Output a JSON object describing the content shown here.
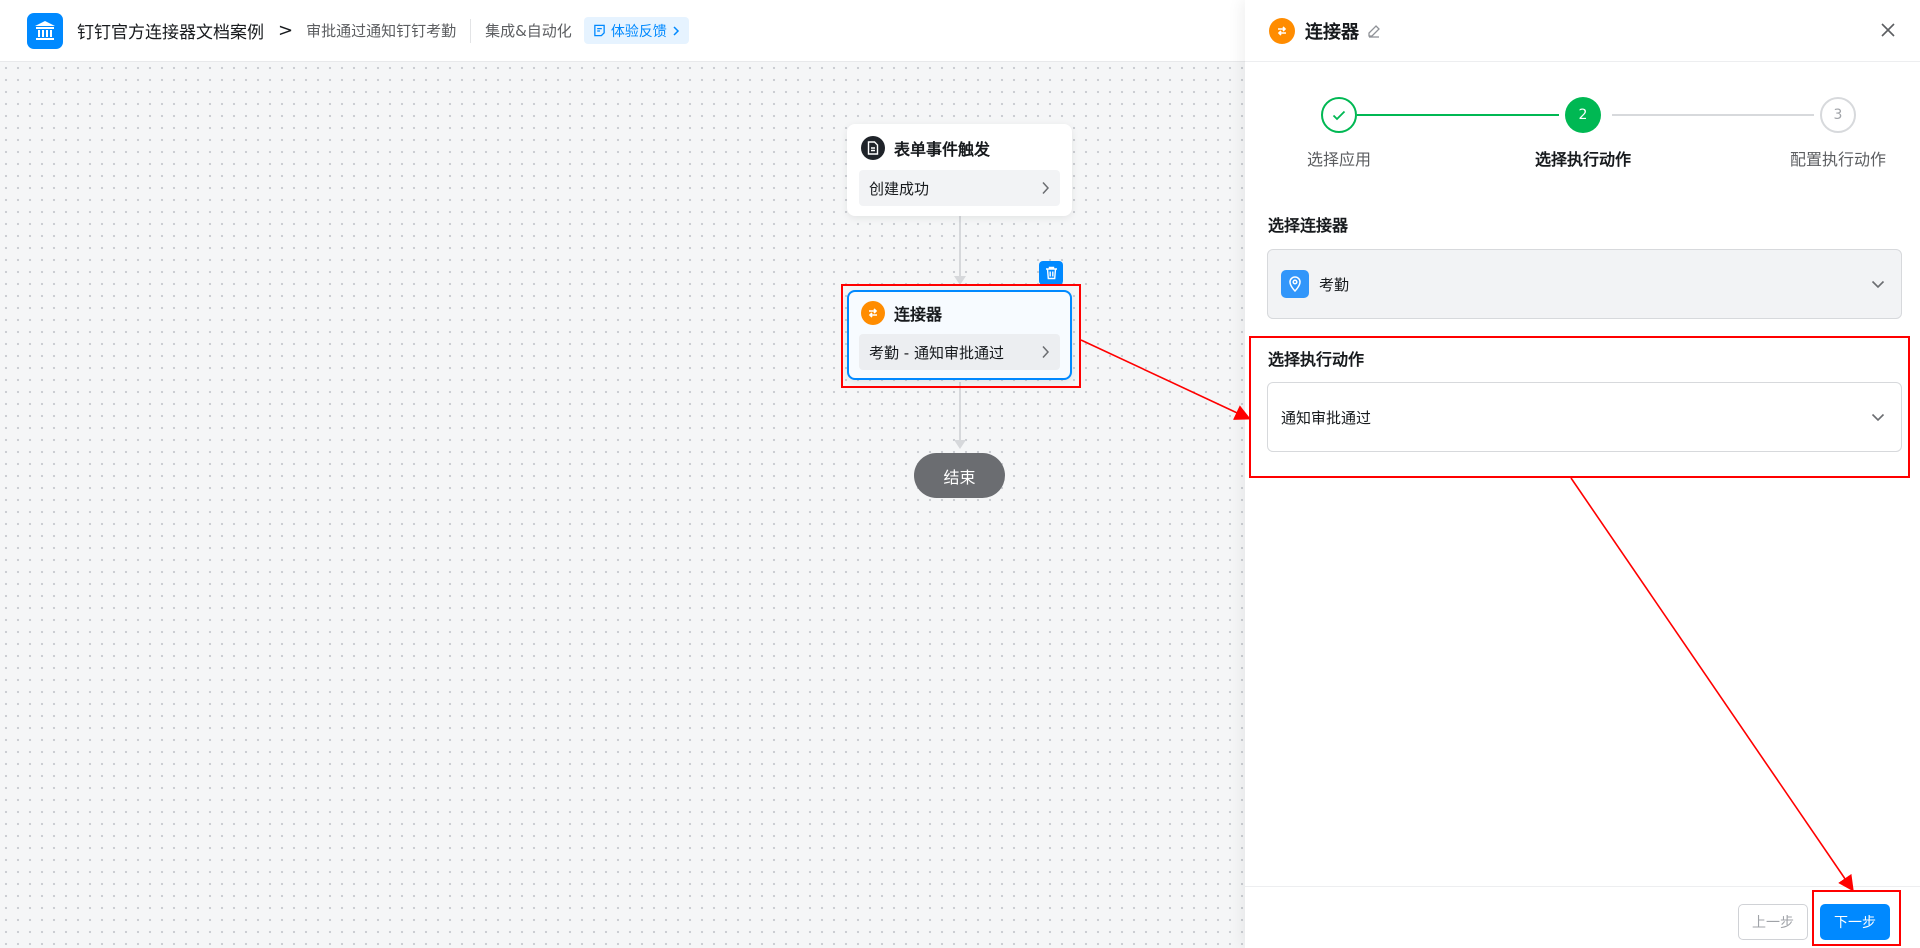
{
  "header": {
    "app_name": "钉钉官方连接器文档案例",
    "breadcrumb_sep": ">",
    "flow_name": "审批通过通知钉钉考勤",
    "category": "集成&自动化",
    "feedback_label": "体验反馈"
  },
  "canvas": {
    "trigger_node": {
      "title": "表单事件触发",
      "value": "创建成功"
    },
    "connector_node": {
      "title": "连接器",
      "value": "考勤 - 通知审批通过"
    },
    "end_node": {
      "label": "结束"
    }
  },
  "panel": {
    "title": "连接器",
    "steps": [
      {
        "label": "选择应用",
        "state": "done"
      },
      {
        "label": "选择执行动作",
        "number": "2",
        "state": "active"
      },
      {
        "label": "配置执行动作",
        "number": "3",
        "state": "pending"
      }
    ],
    "connector_field": {
      "label": "选择连接器",
      "value": "考勤"
    },
    "action_field": {
      "label": "选择执行动作",
      "value": "通知审批通过"
    },
    "buttons": {
      "prev": "上一步",
      "next": "下一步"
    }
  },
  "colors": {
    "primary": "#0089ff",
    "success": "#00b853",
    "connector_orange": "#ff8c00",
    "annotation_red": "#ff0000"
  },
  "icons": {
    "app_logo": "bank-building-icon",
    "connector": "connector-icon",
    "form": "document-icon",
    "trash": "trash-icon",
    "close": "close-icon",
    "edit": "pencil-icon",
    "attendance_app": "location-pin-icon"
  }
}
